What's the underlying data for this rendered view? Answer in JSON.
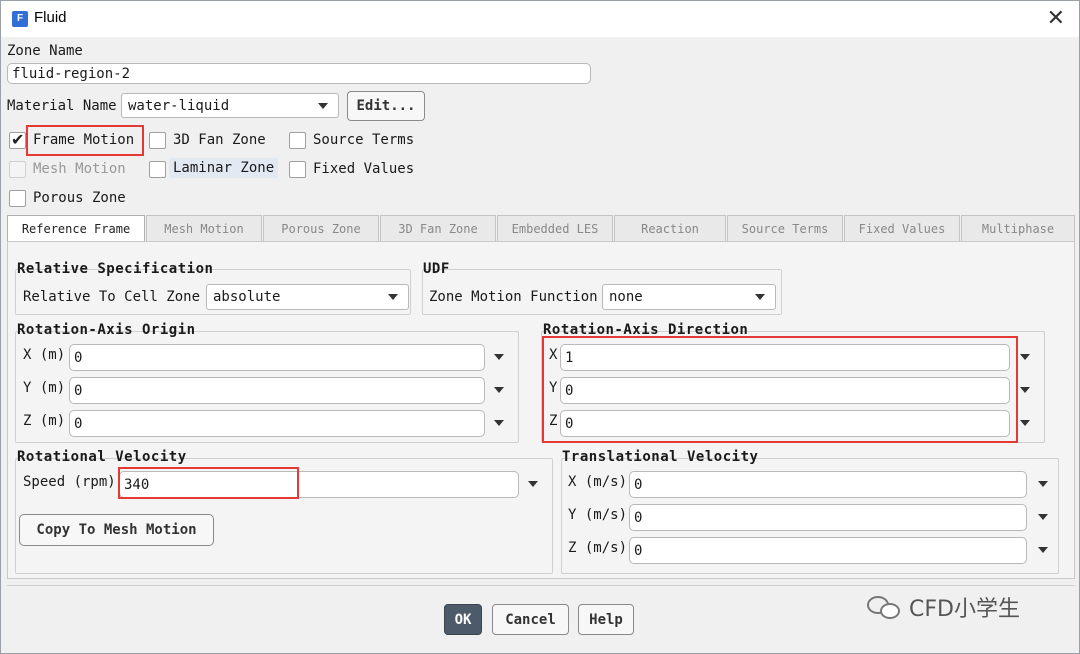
{
  "window": {
    "title": "Fluid",
    "icon": "app-icon"
  },
  "zone_name": {
    "label": "Zone Name",
    "value": "fluid-region-2"
  },
  "material": {
    "label": "Material Name",
    "value": "water-liquid",
    "edit_button": "Edit..."
  },
  "checkboxes": {
    "frame_motion": {
      "label": "Frame Motion",
      "checked": true
    },
    "fan_zone_3d": {
      "label": "3D Fan Zone",
      "checked": false
    },
    "source_terms": {
      "label": "Source Terms",
      "checked": false
    },
    "mesh_motion": {
      "label": "Mesh Motion",
      "checked": false,
      "disabled": true
    },
    "laminar_zone": {
      "label": "Laminar Zone",
      "checked": false
    },
    "fixed_values": {
      "label": "Fixed Values",
      "checked": false
    },
    "porous_zone": {
      "label": "Porous Zone",
      "checked": false
    }
  },
  "tabs": [
    "Reference Frame",
    "Mesh Motion",
    "Porous Zone",
    "3D Fan Zone",
    "Embedded LES",
    "Reaction",
    "Source Terms",
    "Fixed Values",
    "Multiphase"
  ],
  "active_tab": "Reference Frame",
  "relative_spec": {
    "title": "Relative Specification",
    "label": "Relative To Cell Zone",
    "value": "absolute"
  },
  "udf": {
    "title": "UDF",
    "label": "Zone Motion Function",
    "value": "none"
  },
  "axis_origin": {
    "title": "Rotation-Axis Origin",
    "x_label": "X (m)",
    "x_value": "0",
    "y_label": "Y (m)",
    "y_value": "0",
    "z_label": "Z (m)",
    "z_value": "0"
  },
  "axis_direction": {
    "title": "Rotation-Axis Direction",
    "x_label": "X",
    "x_value": "1",
    "y_label": "Y",
    "y_value": "0",
    "z_label": "Z",
    "z_value": "0"
  },
  "rotational_velocity": {
    "title": "Rotational Velocity",
    "label": "Speed (rpm)",
    "value": "340",
    "copy_button": "Copy To Mesh Motion"
  },
  "translational_velocity": {
    "title": "Translational Velocity",
    "x_label": "X (m/s)",
    "x_value": "0",
    "y_label": "Y (m/s)",
    "y_value": "0",
    "z_label": "Z (m/s)",
    "z_value": "0"
  },
  "buttons": {
    "ok": "OK",
    "cancel": "Cancel",
    "help": "Help"
  },
  "watermark": "CFD小学生",
  "colors": {
    "highlight": "#e53935",
    "primary_button": "#4c5a6a",
    "app_icon": "#2f6fd6"
  }
}
